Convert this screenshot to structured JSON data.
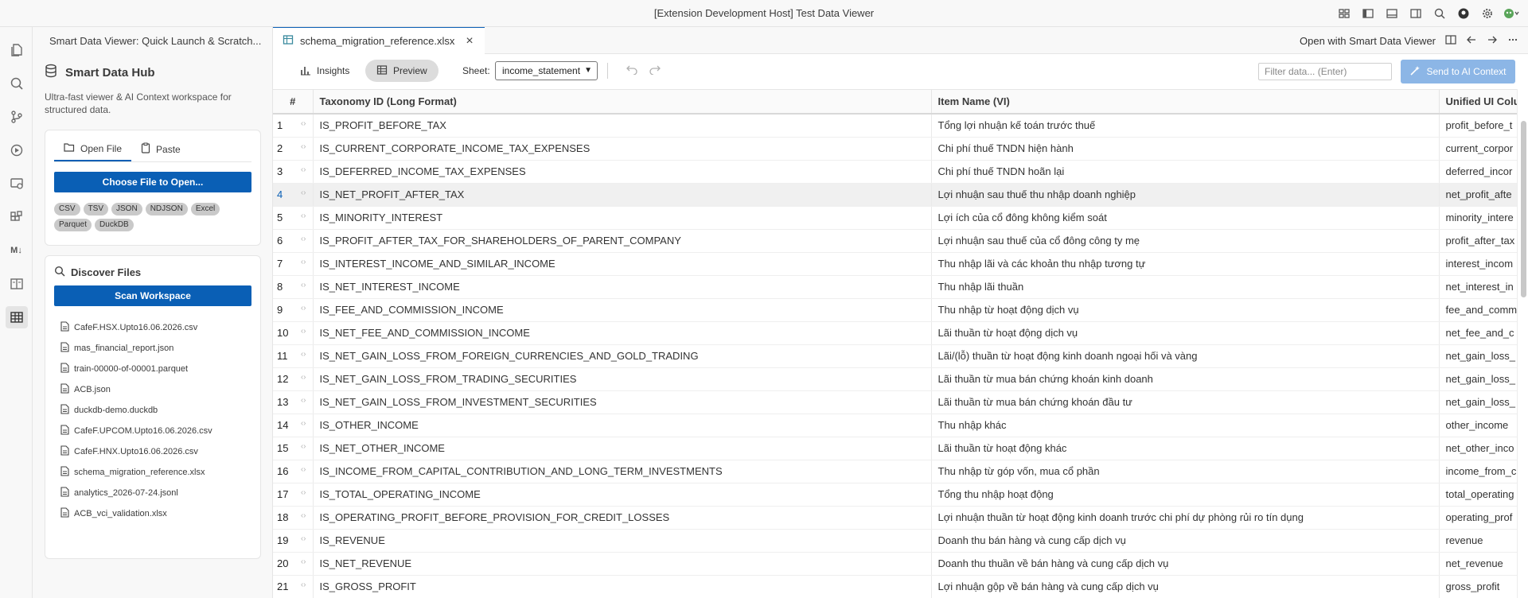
{
  "window": {
    "title": "[Extension Development Host] Test Data Viewer"
  },
  "sidebar": {
    "header": "Smart Data Viewer: Quick Launch & Scratch...",
    "hub_title": "Smart Data Hub",
    "hub_desc": "Ultra-fast viewer & AI Context workspace for structured data.",
    "tabs": [
      {
        "label": "Open File",
        "icon": "folder-open-icon",
        "active": true
      },
      {
        "label": "Paste",
        "icon": "clipboard-icon",
        "active": false
      }
    ],
    "choose_button": "Choose File to Open...",
    "formats": [
      "CSV",
      "TSV",
      "JSON",
      "NDJSON",
      "Excel",
      "Parquet",
      "DuckDB"
    ],
    "discover_title": "Discover Files",
    "scan_button": "Scan Workspace",
    "files": [
      "CafeF.HSX.Upto16.06.2026.csv",
      "mas_financial_report.json",
      "train-00000-of-00001.parquet",
      "ACB.json",
      "duckdb-demo.duckdb",
      "CafeF.UPCOM.Upto16.06.2026.csv",
      "CafeF.HNX.Upto16.06.2026.csv",
      "schema_migration_reference.xlsx",
      "analytics_2026-07-24.jsonl",
      "ACB_vci_validation.xlsx"
    ]
  },
  "editor": {
    "tab_label": "schema_migration_reference.xlsx",
    "open_with": "Open with Smart Data Viewer",
    "insights_label": "Insights",
    "preview_label": "Preview",
    "sheet_label": "Sheet:",
    "sheet_value": "income_statement",
    "filter_placeholder": "Filter data... (Enter)",
    "send_label": "Send to AI Context",
    "accent": "#0a5fb5"
  },
  "table": {
    "headers": [
      "#",
      "Taxonomy ID (Long Format)",
      "Item Name (VI)",
      "Unified UI Colu"
    ],
    "highlighted_row": 4,
    "rows": [
      [
        "1",
        "IS_PROFIT_BEFORE_TAX",
        "Tổng lợi nhuận kế toán trước thuế",
        "profit_before_t"
      ],
      [
        "2",
        "IS_CURRENT_CORPORATE_INCOME_TAX_EXPENSES",
        "Chi phí thuế TNDN hiện hành",
        "current_corpor"
      ],
      [
        "3",
        "IS_DEFERRED_INCOME_TAX_EXPENSES",
        "Chi phí thuế TNDN hoãn lại",
        "deferred_incor"
      ],
      [
        "4",
        "IS_NET_PROFIT_AFTER_TAX",
        "Lợi nhuận sau thuế thu nhập doanh nghiệp",
        "net_profit_afte"
      ],
      [
        "5",
        "IS_MINORITY_INTEREST",
        "Lợi ích của cổ đông không kiểm soát",
        "minority_intere"
      ],
      [
        "6",
        "IS_PROFIT_AFTER_TAX_FOR_SHAREHOLDERS_OF_PARENT_COMPANY",
        "Lợi nhuận sau thuế của cổ đông công ty mẹ",
        "profit_after_tax"
      ],
      [
        "7",
        "IS_INTEREST_INCOME_AND_SIMILAR_INCOME",
        "Thu nhập lãi và các khoản thu nhập tương tự",
        "interest_incom"
      ],
      [
        "8",
        "IS_NET_INTEREST_INCOME",
        "Thu nhập lãi thuần",
        "net_interest_in"
      ],
      [
        "9",
        "IS_FEE_AND_COMMISSION_INCOME",
        "Thu nhập từ hoạt động dịch vụ",
        "fee_and_comm"
      ],
      [
        "10",
        "IS_NET_FEE_AND_COMMISSION_INCOME",
        "Lãi thuần từ hoạt động dịch vụ",
        "net_fee_and_c"
      ],
      [
        "11",
        "IS_NET_GAIN_LOSS_FROM_FOREIGN_CURRENCIES_AND_GOLD_TRADING",
        "Lãi/(lỗ) thuần từ hoạt động kinh doanh ngoại hối và vàng",
        "net_gain_loss_"
      ],
      [
        "12",
        "IS_NET_GAIN_LOSS_FROM_TRADING_SECURITIES",
        "Lãi thuần từ mua bán chứng khoán kinh doanh",
        "net_gain_loss_"
      ],
      [
        "13",
        "IS_NET_GAIN_LOSS_FROM_INVESTMENT_SECURITIES",
        "Lãi thuần từ mua bán chứng khoán đầu tư",
        "net_gain_loss_"
      ],
      [
        "14",
        "IS_OTHER_INCOME",
        "Thu nhập khác",
        "other_income"
      ],
      [
        "15",
        "IS_NET_OTHER_INCOME",
        "Lãi thuần từ hoạt động khác",
        "net_other_inco"
      ],
      [
        "16",
        "IS_INCOME_FROM_CAPITAL_CONTRIBUTION_AND_LONG_TERM_INVESTMENTS",
        "Thu nhập từ góp vốn, mua cổ phần",
        "income_from_c"
      ],
      [
        "17",
        "IS_TOTAL_OPERATING_INCOME",
        "Tổng thu nhập hoạt động",
        "total_operating"
      ],
      [
        "18",
        "IS_OPERATING_PROFIT_BEFORE_PROVISION_FOR_CREDIT_LOSSES",
        "Lợi nhuận thuần từ hoạt động kinh doanh trước chi phí dự phòng rủi ro tín dụng",
        "operating_prof"
      ],
      [
        "19",
        "IS_REVENUE",
        "Doanh thu bán hàng và cung cấp dịch vụ",
        "revenue"
      ],
      [
        "20",
        "IS_NET_REVENUE",
        "Doanh thu thuần về bán hàng và cung cấp dịch vụ",
        "net_revenue"
      ],
      [
        "21",
        "IS_GROSS_PROFIT",
        "Lợi nhuận gộp về bán hàng và cung cấp dịch vụ",
        "gross_profit"
      ]
    ]
  }
}
